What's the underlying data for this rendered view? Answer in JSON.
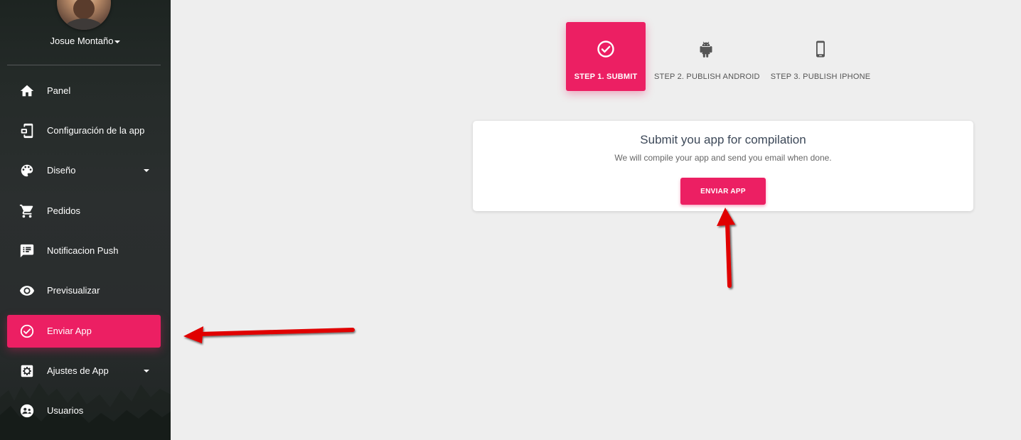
{
  "user": {
    "name": "Josue Montaño"
  },
  "sidebar": {
    "items": [
      {
        "label": "Panel",
        "icon": "home-icon"
      },
      {
        "label": "Configuración de la app",
        "icon": "app-settings-icon"
      },
      {
        "label": "Diseño",
        "icon": "palette-icon",
        "has_submenu": true
      },
      {
        "label": "Pedidos",
        "icon": "cart-icon"
      },
      {
        "label": "Notificacion Push",
        "icon": "message-icon"
      },
      {
        "label": "Previsualizar",
        "icon": "eye-icon"
      },
      {
        "label": "Enviar App",
        "icon": "check-circle-icon",
        "active": true
      },
      {
        "label": "Ajustes de App",
        "icon": "gear-icon",
        "has_submenu": true
      },
      {
        "label": "Usuarios",
        "icon": "users-icon"
      }
    ]
  },
  "steps": [
    {
      "label": "STEP 1. SUBMIT",
      "icon": "check-circle-icon",
      "active": true
    },
    {
      "label": "STEP 2. PUBLISH ANDROID",
      "icon": "android-icon"
    },
    {
      "label": "STEP 3. PUBLISH IPHONE",
      "icon": "phone-icon"
    }
  ],
  "card": {
    "title": "Submit you app for compilation",
    "subtitle": "We will compile your app and send you email when done.",
    "button_label": "ENVIAR APP"
  },
  "colors": {
    "accent": "#ec1f63",
    "background": "#eeeeee",
    "sidebar": "#2a2d2e",
    "annotation_arrow": "#e00000"
  }
}
